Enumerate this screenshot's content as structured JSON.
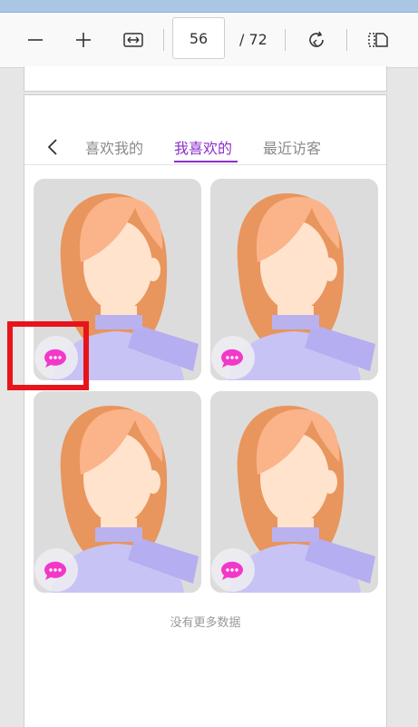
{
  "toolbar": {
    "zoom_out_icon": "minus-icon",
    "zoom_in_icon": "plus-icon",
    "fit_width_icon": "fit-width-icon",
    "current_page": "56",
    "page_total": "/ 72",
    "rotate_icon": "rotate-icon",
    "two_page_icon": "page-view-icon"
  },
  "app": {
    "back_icon": "chevron-left-icon",
    "tabs": [
      {
        "label": "喜欢我的",
        "active": false
      },
      {
        "label": "我喜欢的",
        "active": true
      },
      {
        "label": "最近访客",
        "active": false
      }
    ],
    "accent_color": "#8b2fc9",
    "cards": [
      {
        "avatar": "avatar-placeholder",
        "chat_icon": "chat-bubble-icon"
      },
      {
        "avatar": "avatar-placeholder",
        "chat_icon": "chat-bubble-icon"
      },
      {
        "avatar": "avatar-placeholder",
        "chat_icon": "chat-bubble-icon"
      },
      {
        "avatar": "avatar-placeholder",
        "chat_icon": "chat-bubble-icon"
      }
    ],
    "no_more_text": "没有更多数据"
  },
  "annotation_color": "#e8141c"
}
